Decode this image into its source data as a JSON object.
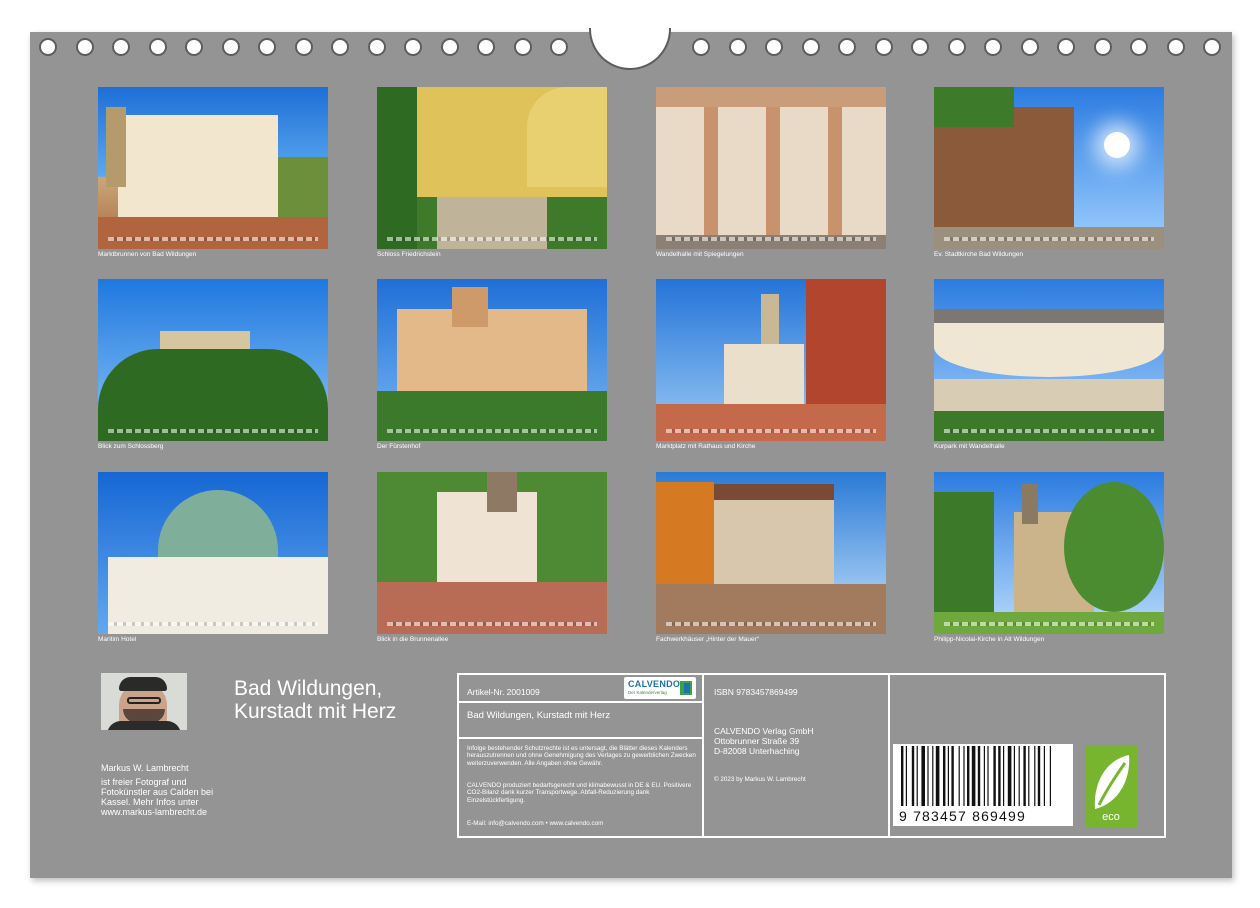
{
  "photos": [
    {
      "caption": "Marktbrunnen von Bad Wildungen"
    },
    {
      "caption": "Schloss Friedrichstein"
    },
    {
      "caption": "Wandelhalle mit Spiegelungen"
    },
    {
      "caption": "Ev. Stadtkirche Bad Wildungen"
    },
    {
      "caption": "Blick zum Schlossberg"
    },
    {
      "caption": "Der Fürstenhof"
    },
    {
      "caption": "Marktplatz mit Rathaus und Kirche"
    },
    {
      "caption": "Kurpark mit Wandelhalle"
    },
    {
      "caption": "Maritim Hotel"
    },
    {
      "caption": "Blick in die Brunnenallee"
    },
    {
      "caption": "Fachwerkhäuser „Hinter der Mauer“"
    },
    {
      "caption": "Philipp-Nicolai-Kirche in Alt Wildungen"
    }
  ],
  "calendar": {
    "title_line1": "Bad Wildungen,",
    "title_line2": "Kurstadt mit Herz"
  },
  "author": {
    "name": "Markus W. Lambrecht",
    "bio": "ist freier Fotograf und Fotokünstler aus Calden bei Kassel. Mehr Infos unter www.markus-lambrecht.de"
  },
  "info": {
    "article": "Artikel-Nr. 2001009",
    "product_title": "Bad Wildungen, Kurstadt mit Herz",
    "rights_text": "Infolge bestehender Schutzrechte ist es untersagt, die Blätter dieses Kalenders herauszutrennen und ohne Genehmigung des Verlages zu gewerblichen Zwecken weiterzuverwenden. Alle Angaben ohne Gewähr.",
    "eco_text": "CALVENDO produziert bedarfsgerecht und klimabewusst in DE & EU. Positivere CO2-Bilanz dank kurzer Transportwege. Abfall-Reduzierung dank Einzelstückfertigung.",
    "contact": "E-Mail: info@calvendo.com • www.calvendo.com",
    "isbn": "ISBN 9783457869499",
    "publisher_name": "CALVENDO Verlag GmbH",
    "publisher_street": "Ottobrunner Straße 39",
    "publisher_city": "D-82008 Unterhaching",
    "copyright": "© 2023 by Markus W. Lambrecht"
  },
  "logo": {
    "word": "CALVENDO",
    "tagline": "Der Kalenderverlag"
  },
  "barcode": {
    "digits": "9 783457 869499"
  },
  "eco_badge": {
    "label": "eco"
  }
}
